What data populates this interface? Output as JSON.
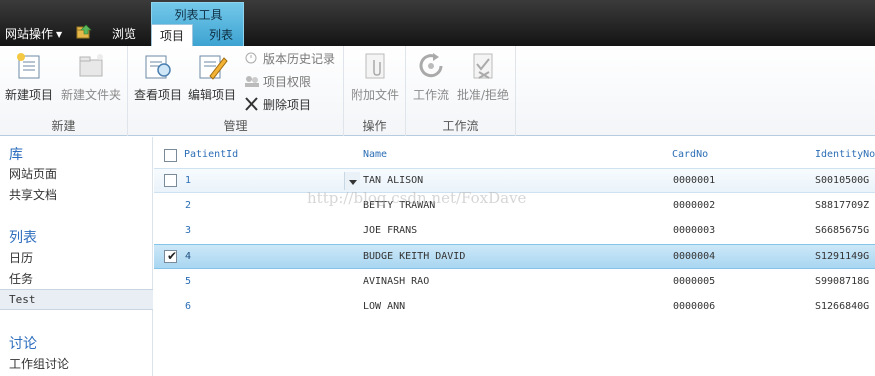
{
  "topbar": {
    "site_actions": "网站操作",
    "browse": "浏览",
    "context_group": "列表工具",
    "tab_items": "项目",
    "tab_list": "列表"
  },
  "ribbon": {
    "groups": {
      "new": "新建",
      "manage": "管理",
      "actions": "操作",
      "workflow": "工作流"
    },
    "buttons": {
      "new_item": "新建项目",
      "new_folder": "新建文件夹",
      "view_item": "查看项目",
      "edit_item": "编辑项目",
      "version_history": "版本历史记录",
      "item_permissions": "项目权限",
      "delete_item": "删除项目",
      "attach_file": "附加文件",
      "workflows": "工作流",
      "approve_reject": "批准/拒绝"
    }
  },
  "leftnav": {
    "libraries_head": "库",
    "site_pages": "网站页面",
    "shared_docs": "共享文档",
    "lists_head": "列表",
    "calendar": "日历",
    "tasks": "任务",
    "test": "Test",
    "discussions_head": "讨论",
    "team_discussion": "工作组讨论"
  },
  "grid": {
    "columns": [
      "PatientId",
      "Name",
      "CardNo",
      "IdentityNo"
    ],
    "rows": [
      {
        "id": "1",
        "name": "TAN ALISON",
        "card": "0000001",
        "identity": "S0010500G",
        "state": "hover"
      },
      {
        "id": "2",
        "name": "BETTY TRAWAN",
        "card": "0000002",
        "identity": "S8817709Z",
        "state": "normal"
      },
      {
        "id": "3",
        "name": "JOE FRANS",
        "card": "0000003",
        "identity": "S6685675G",
        "state": "normal"
      },
      {
        "id": "4",
        "name": "BUDGE KEITH DAVID",
        "card": "0000004",
        "identity": "S1291149G",
        "state": "selected"
      },
      {
        "id": "5",
        "name": "AVINASH RAO",
        "card": "0000005",
        "identity": "S9908718G",
        "state": "normal"
      },
      {
        "id": "6",
        "name": "LOW ANN",
        "card": "0000006",
        "identity": "S1266840G",
        "state": "normal"
      }
    ]
  },
  "watermark": "http://blog.csdn.net/FoxDave",
  "colors": {
    "accent": "#2c6eb5",
    "context_tab": "#3da3d1",
    "selected_row": "#a8d6f1"
  }
}
